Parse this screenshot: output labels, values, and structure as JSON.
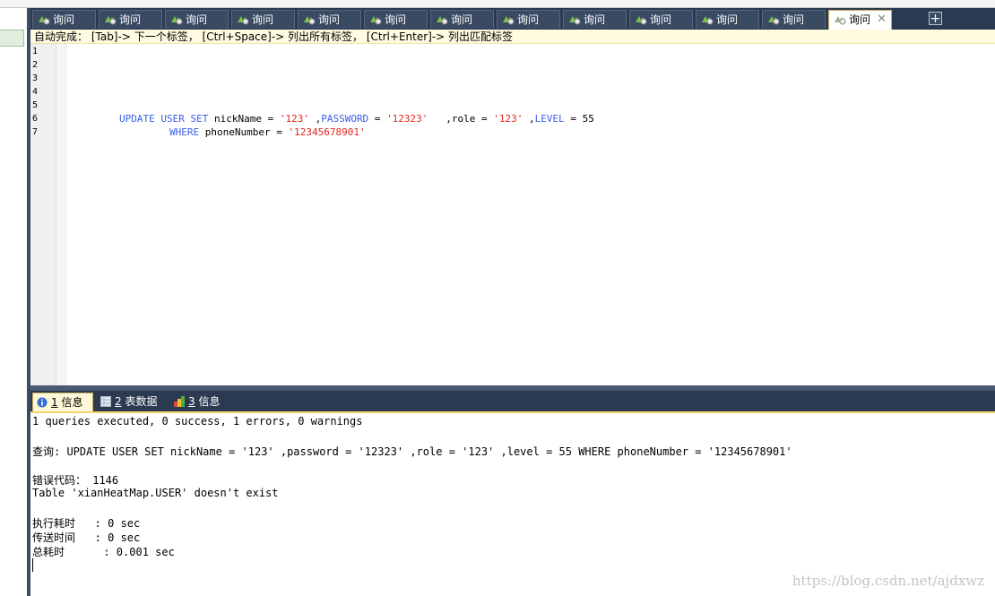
{
  "tabs": [
    {
      "label": "询问",
      "icon": "query-icon",
      "active": false
    },
    {
      "label": "询问",
      "icon": "query-icon",
      "active": false
    },
    {
      "label": "询问",
      "icon": "query-icon",
      "active": false
    },
    {
      "label": "询问",
      "icon": "query-icon",
      "active": false
    },
    {
      "label": "询问",
      "icon": "query-icon",
      "active": false
    },
    {
      "label": "询问",
      "icon": "query-icon",
      "active": false
    },
    {
      "label": "询问",
      "icon": "query-icon",
      "active": false
    },
    {
      "label": "询问",
      "icon": "query-icon",
      "active": false
    },
    {
      "label": "询问",
      "icon": "query-icon",
      "active": false
    },
    {
      "label": "询问",
      "icon": "query-icon",
      "active": false
    },
    {
      "label": "询问",
      "icon": "query-icon",
      "active": false
    },
    {
      "label": "询问",
      "icon": "query-icon",
      "active": false
    },
    {
      "label": "询问",
      "icon": "query-icon",
      "active": true
    }
  ],
  "tab_close": "✕",
  "add_tab": "+",
  "hint": "自动完成： [Tab]-> 下一个标签， [Ctrl+Space]-> 列出所有标签， [Ctrl+Enter]-> 列出匹配标签",
  "editor": {
    "line_numbers": [
      "1",
      "2",
      "3",
      "4",
      "5",
      "6",
      "7"
    ],
    "line6": {
      "k1": "UPDATE USER SET",
      "t1": " nickName = ",
      "s1": "'123'",
      "t2": " ,",
      "k2": "PASSWORD",
      "t3": " = ",
      "s2": "'12323'",
      "t4": "   ,role = ",
      "s3": "'123'",
      "t5": " ,",
      "k3": "LEVEL",
      "t6": " = 55"
    },
    "line7": {
      "k1": "WHERE",
      "t1": " phoneNumber = ",
      "s1": "'12345678901'"
    }
  },
  "result_tabs": [
    {
      "num": "1",
      "label": " 信息",
      "icon": "info-icon",
      "active": true
    },
    {
      "num": "2",
      "label": " 表数据",
      "icon": "table-icon",
      "active": false
    },
    {
      "num": "3",
      "label": " 信息",
      "icon": "chart-icon",
      "active": false
    }
  ],
  "output": {
    "summary": "1 queries executed, 0 success, 1 errors, 0 warnings",
    "query": "查询: UPDATE USER SET nickName = '123' ,password = '12323' ,role = '123' ,level = 55 WHERE phoneNumber = '12345678901'",
    "error_code": "错误代码： 1146",
    "error_msg": "Table 'xianHeatMap.USER' doesn't exist",
    "exec_time": "执行耗时   : 0 sec",
    "transfer_time": "传送时间   : 0 sec",
    "total_time": "总耗时      : 0.001 sec"
  },
  "watermark": "https://blog.csdn.net/ajdxwz",
  "colors": {
    "keyword": "#3b5ee8",
    "string": "#e0261a",
    "tab_bar": "#2b3a50",
    "active_tab_border": "#c9b063"
  }
}
